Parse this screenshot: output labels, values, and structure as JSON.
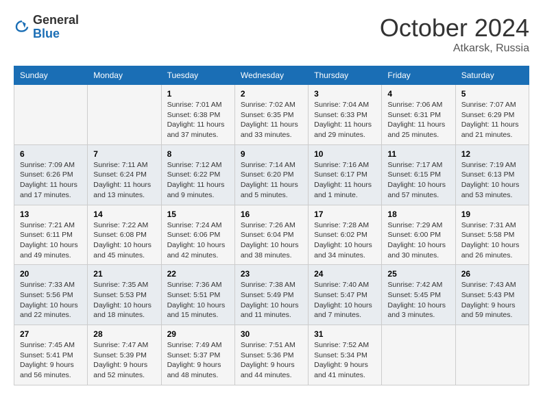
{
  "logo": {
    "general": "General",
    "blue": "Blue"
  },
  "header": {
    "month": "October 2024",
    "location": "Atkarsk, Russia"
  },
  "weekdays": [
    "Sunday",
    "Monday",
    "Tuesday",
    "Wednesday",
    "Thursday",
    "Friday",
    "Saturday"
  ],
  "weeks": [
    [
      {
        "day": "",
        "info": ""
      },
      {
        "day": "",
        "info": ""
      },
      {
        "day": "1",
        "info": "Sunrise: 7:01 AM\nSunset: 6:38 PM\nDaylight: 11 hours\nand 37 minutes."
      },
      {
        "day": "2",
        "info": "Sunrise: 7:02 AM\nSunset: 6:35 PM\nDaylight: 11 hours\nand 33 minutes."
      },
      {
        "day": "3",
        "info": "Sunrise: 7:04 AM\nSunset: 6:33 PM\nDaylight: 11 hours\nand 29 minutes."
      },
      {
        "day": "4",
        "info": "Sunrise: 7:06 AM\nSunset: 6:31 PM\nDaylight: 11 hours\nand 25 minutes."
      },
      {
        "day": "5",
        "info": "Sunrise: 7:07 AM\nSunset: 6:29 PM\nDaylight: 11 hours\nand 21 minutes."
      }
    ],
    [
      {
        "day": "6",
        "info": "Sunrise: 7:09 AM\nSunset: 6:26 PM\nDaylight: 11 hours\nand 17 minutes."
      },
      {
        "day": "7",
        "info": "Sunrise: 7:11 AM\nSunset: 6:24 PM\nDaylight: 11 hours\nand 13 minutes."
      },
      {
        "day": "8",
        "info": "Sunrise: 7:12 AM\nSunset: 6:22 PM\nDaylight: 11 hours\nand 9 minutes."
      },
      {
        "day": "9",
        "info": "Sunrise: 7:14 AM\nSunset: 6:20 PM\nDaylight: 11 hours\nand 5 minutes."
      },
      {
        "day": "10",
        "info": "Sunrise: 7:16 AM\nSunset: 6:17 PM\nDaylight: 11 hours\nand 1 minute."
      },
      {
        "day": "11",
        "info": "Sunrise: 7:17 AM\nSunset: 6:15 PM\nDaylight: 10 hours\nand 57 minutes."
      },
      {
        "day": "12",
        "info": "Sunrise: 7:19 AM\nSunset: 6:13 PM\nDaylight: 10 hours\nand 53 minutes."
      }
    ],
    [
      {
        "day": "13",
        "info": "Sunrise: 7:21 AM\nSunset: 6:11 PM\nDaylight: 10 hours\nand 49 minutes."
      },
      {
        "day": "14",
        "info": "Sunrise: 7:22 AM\nSunset: 6:08 PM\nDaylight: 10 hours\nand 45 minutes."
      },
      {
        "day": "15",
        "info": "Sunrise: 7:24 AM\nSunset: 6:06 PM\nDaylight: 10 hours\nand 42 minutes."
      },
      {
        "day": "16",
        "info": "Sunrise: 7:26 AM\nSunset: 6:04 PM\nDaylight: 10 hours\nand 38 minutes."
      },
      {
        "day": "17",
        "info": "Sunrise: 7:28 AM\nSunset: 6:02 PM\nDaylight: 10 hours\nand 34 minutes."
      },
      {
        "day": "18",
        "info": "Sunrise: 7:29 AM\nSunset: 6:00 PM\nDaylight: 10 hours\nand 30 minutes."
      },
      {
        "day": "19",
        "info": "Sunrise: 7:31 AM\nSunset: 5:58 PM\nDaylight: 10 hours\nand 26 minutes."
      }
    ],
    [
      {
        "day": "20",
        "info": "Sunrise: 7:33 AM\nSunset: 5:56 PM\nDaylight: 10 hours\nand 22 minutes."
      },
      {
        "day": "21",
        "info": "Sunrise: 7:35 AM\nSunset: 5:53 PM\nDaylight: 10 hours\nand 18 minutes."
      },
      {
        "day": "22",
        "info": "Sunrise: 7:36 AM\nSunset: 5:51 PM\nDaylight: 10 hours\nand 15 minutes."
      },
      {
        "day": "23",
        "info": "Sunrise: 7:38 AM\nSunset: 5:49 PM\nDaylight: 10 hours\nand 11 minutes."
      },
      {
        "day": "24",
        "info": "Sunrise: 7:40 AM\nSunset: 5:47 PM\nDaylight: 10 hours\nand 7 minutes."
      },
      {
        "day": "25",
        "info": "Sunrise: 7:42 AM\nSunset: 5:45 PM\nDaylight: 10 hours\nand 3 minutes."
      },
      {
        "day": "26",
        "info": "Sunrise: 7:43 AM\nSunset: 5:43 PM\nDaylight: 9 hours\nand 59 minutes."
      }
    ],
    [
      {
        "day": "27",
        "info": "Sunrise: 7:45 AM\nSunset: 5:41 PM\nDaylight: 9 hours\nand 56 minutes."
      },
      {
        "day": "28",
        "info": "Sunrise: 7:47 AM\nSunset: 5:39 PM\nDaylight: 9 hours\nand 52 minutes."
      },
      {
        "day": "29",
        "info": "Sunrise: 7:49 AM\nSunset: 5:37 PM\nDaylight: 9 hours\nand 48 minutes."
      },
      {
        "day": "30",
        "info": "Sunrise: 7:51 AM\nSunset: 5:36 PM\nDaylight: 9 hours\nand 44 minutes."
      },
      {
        "day": "31",
        "info": "Sunrise: 7:52 AM\nSunset: 5:34 PM\nDaylight: 9 hours\nand 41 minutes."
      },
      {
        "day": "",
        "info": ""
      },
      {
        "day": "",
        "info": ""
      }
    ]
  ]
}
